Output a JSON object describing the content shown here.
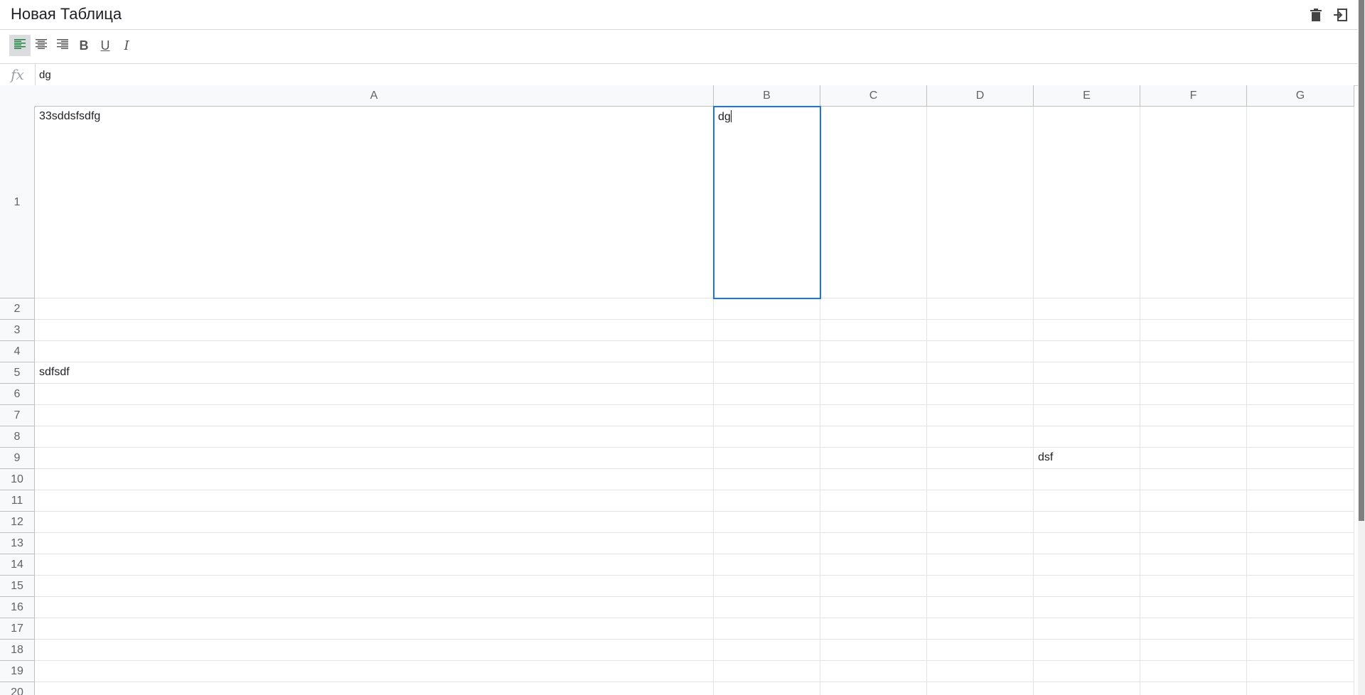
{
  "header": {
    "title": "Новая Таблица",
    "actions": [
      {
        "name": "delete-button",
        "icon": "trash-icon"
      },
      {
        "name": "exit-button",
        "icon": "exit-icon"
      }
    ]
  },
  "toolbar": {
    "tools": [
      {
        "name": "align-left-button",
        "icon": "align-left-icon",
        "active": true,
        "label": ""
      },
      {
        "name": "align-center-button",
        "icon": "align-center-icon",
        "active": false,
        "label": ""
      },
      {
        "name": "align-right-button",
        "icon": "align-right-icon",
        "active": false,
        "label": ""
      },
      {
        "name": "bold-button",
        "icon": "bold-icon",
        "active": false,
        "label": "B"
      },
      {
        "name": "underline-button",
        "icon": "underline-icon",
        "active": false,
        "label": "U"
      },
      {
        "name": "italic-button",
        "icon": "italic-icon",
        "active": false,
        "label": "I"
      }
    ]
  },
  "formula_bar": {
    "fx_label": "fx",
    "value": "dg"
  },
  "grid": {
    "columns": [
      "A",
      "B",
      "C",
      "D",
      "E",
      "F",
      "G"
    ],
    "rows": [
      "1",
      "2",
      "3",
      "4",
      "5",
      "6",
      "7",
      "8",
      "9",
      "10",
      "11",
      "12",
      "13",
      "14",
      "15",
      "16",
      "17",
      "18",
      "19",
      "20"
    ],
    "cells": {
      "A1": "33sddsfsdfg",
      "B1": "dg",
      "A5": "sdfsdf",
      "E9": "dsf"
    },
    "selected_cell": "B1"
  },
  "colors": {
    "accent": "#1a73e8",
    "align_active": "#188038",
    "header_bg": "#f8f9fa"
  }
}
